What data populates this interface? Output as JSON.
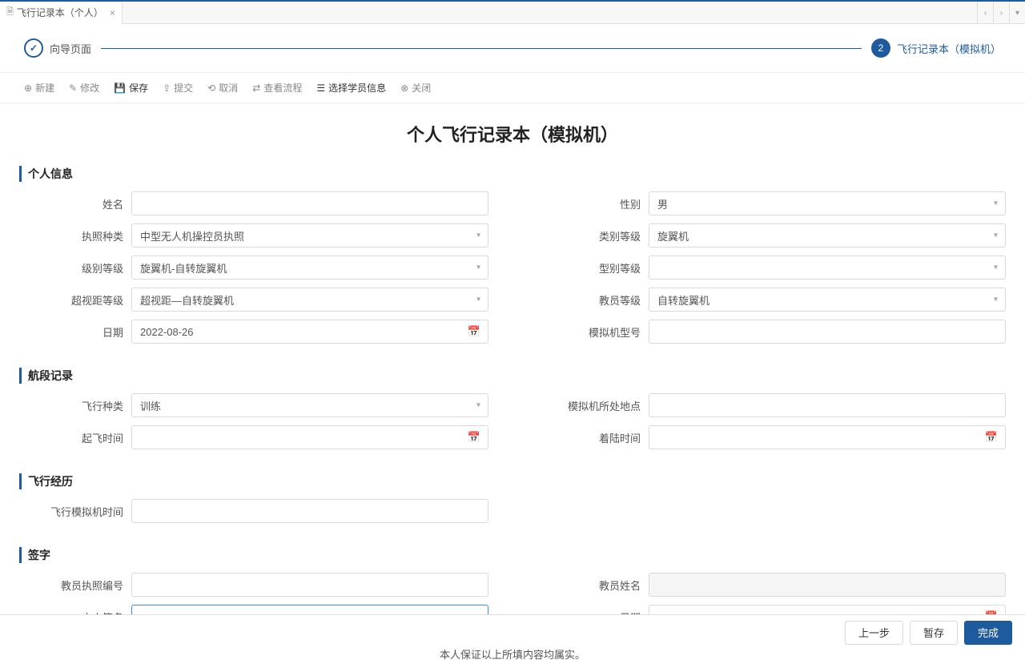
{
  "tab": {
    "title": "飞行记录本（个人）"
  },
  "wizard": {
    "step1": {
      "label": "向导页面"
    },
    "step2": {
      "number": "2",
      "label": "飞行记录本（模拟机）"
    }
  },
  "toolbar": {
    "new": "新建",
    "modify": "修改",
    "save": "保存",
    "submit": "提交",
    "cancel": "取消",
    "workflow": "查看流程",
    "select_student": "选择学员信息",
    "close": "关闭"
  },
  "page_title": "个人飞行记录本（模拟机）",
  "sections": {
    "personal": {
      "title": "个人信息",
      "fields": {
        "name": {
          "label": "姓名",
          "value": ""
        },
        "gender": {
          "label": "性别",
          "value": "男"
        },
        "license_type": {
          "label": "执照种类",
          "value": "中型无人机操控员执照"
        },
        "category_level": {
          "label": "类别等级",
          "value": "旋翼机"
        },
        "class_level": {
          "label": "级别等级",
          "value": "旋翼机-自转旋翼机"
        },
        "type_level": {
          "label": "型别等级",
          "value": ""
        },
        "bvlos_level": {
          "label": "超视距等级",
          "value": "超视距—自转旋翼机"
        },
        "instructor_level": {
          "label": "教员等级",
          "value": "自转旋翼机"
        },
        "date": {
          "label": "日期",
          "value": "2022-08-26"
        },
        "sim_model": {
          "label": "模拟机型号",
          "value": ""
        }
      }
    },
    "segment": {
      "title": "航段记录",
      "fields": {
        "flight_type": {
          "label": "飞行种类",
          "value": "训练"
        },
        "sim_location": {
          "label": "模拟机所处地点",
          "value": ""
        },
        "takeoff_time": {
          "label": "起飞时间",
          "value": ""
        },
        "landing_time": {
          "label": "着陆时间",
          "value": ""
        }
      }
    },
    "experience": {
      "title": "飞行经历",
      "fields": {
        "sim_hours": {
          "label": "飞行模拟机时间",
          "value": ""
        }
      }
    },
    "signature": {
      "title": "签字",
      "fields": {
        "instructor_license_no": {
          "label": "教员执照编号",
          "value": ""
        },
        "instructor_name": {
          "label": "教员姓名",
          "value": ""
        },
        "self_signature": {
          "label": "本人签名",
          "value": ""
        },
        "sig_date": {
          "label": "日期",
          "value": ""
        }
      },
      "declaration": "本人保证以上所填内容均属实。"
    }
  },
  "footer": {
    "prev": "上一步",
    "save_draft": "暂存",
    "finish": "完成"
  }
}
